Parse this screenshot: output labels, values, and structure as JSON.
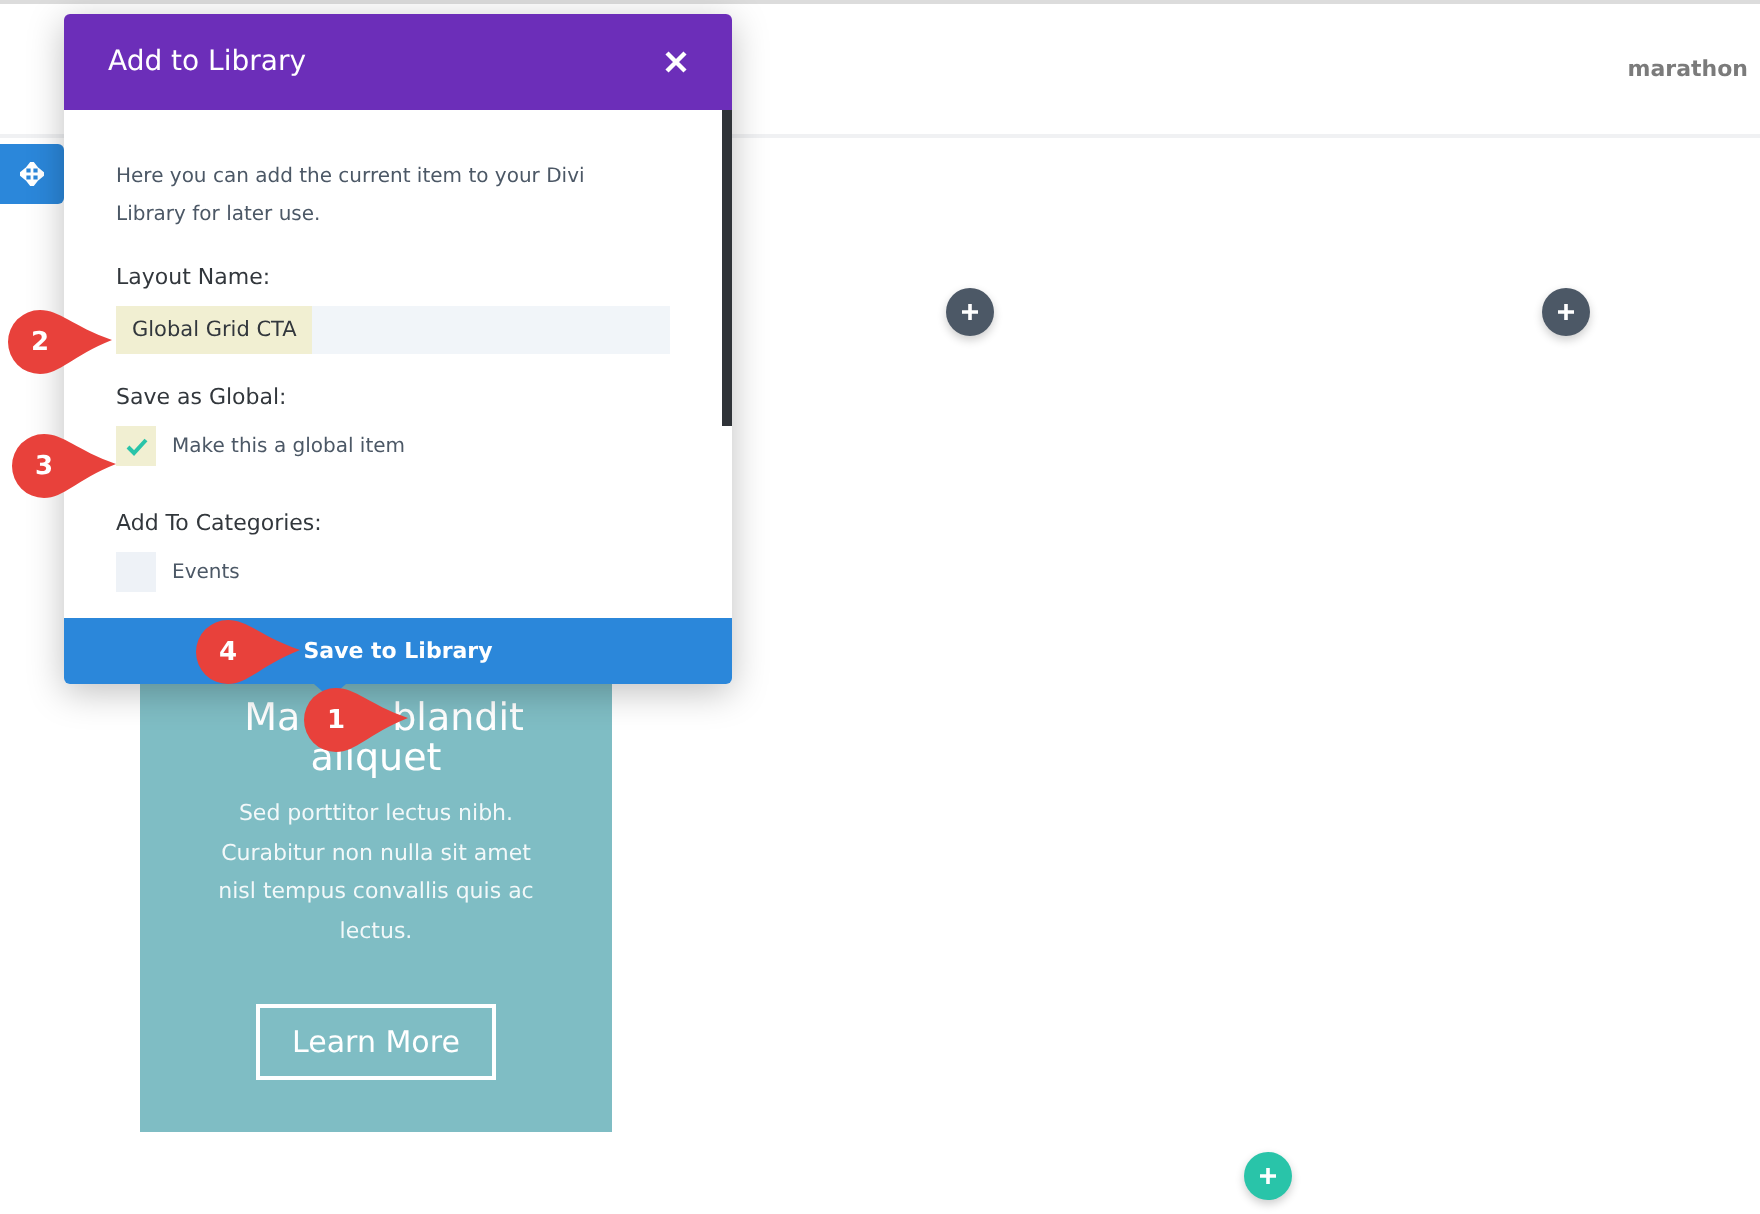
{
  "header": {
    "menu_item": "marathon"
  },
  "modal": {
    "title": "Add to Library",
    "description": "Here you can add the current item to your Divi Library for later use.",
    "layout_name": {
      "label": "Layout Name:",
      "value": "Global Grid CTA",
      "highlighted": true
    },
    "save_as_global": {
      "label": "Save as Global:",
      "option": {
        "label": "Make this a global item",
        "checked": true,
        "highlighted": true
      }
    },
    "categories": {
      "label": "Add To Categories:",
      "items": [
        {
          "label": "Events",
          "checked": false
        }
      ]
    },
    "save_button": "Save to Library"
  },
  "card": {
    "title_start": "Ma",
    "title_end": "blandit",
    "title_line2": "aliquet",
    "body": "Sed porttitor lectus nibh. Curabitur non nulla sit amet nisl tempus convallis quis ac lectus.",
    "button": "Learn More"
  },
  "markers": [
    {
      "number": "2"
    },
    {
      "number": "3"
    },
    {
      "number": "4"
    },
    {
      "number": "1"
    }
  ]
}
